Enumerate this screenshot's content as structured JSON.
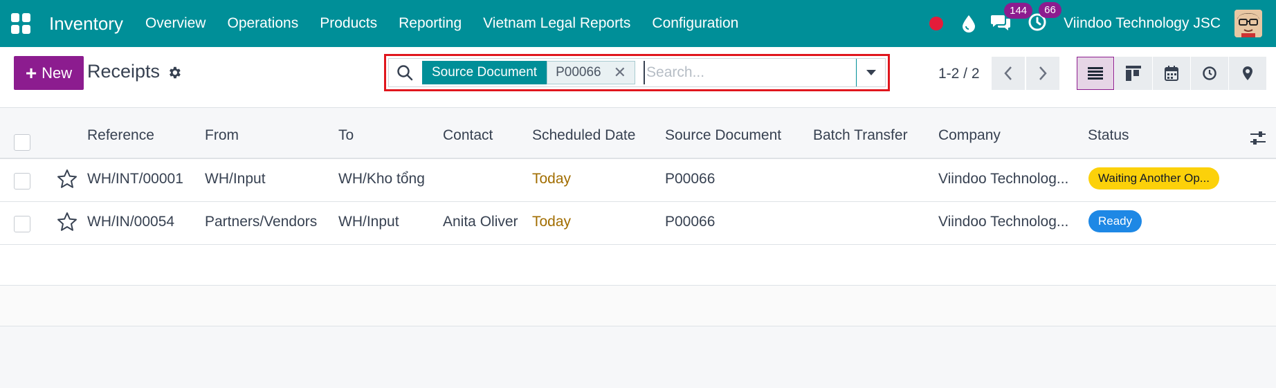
{
  "navbar": {
    "brand": "Inventory",
    "menu": [
      "Overview",
      "Operations",
      "Products",
      "Reporting",
      "Vietnam Legal Reports",
      "Configuration"
    ],
    "messages_count": "144",
    "activities_count": "66",
    "company": "Viindoo Technology JSC"
  },
  "control": {
    "new_label": "New",
    "title": "Receipts",
    "search": {
      "facet_label": "Source Document",
      "facet_value": "P00066",
      "placeholder": "Search..."
    },
    "pager": "1-2 / 2"
  },
  "table": {
    "columns": [
      "Reference",
      "From",
      "To",
      "Contact",
      "Scheduled Date",
      "Source Document",
      "Batch Transfer",
      "Company",
      "Status"
    ],
    "rows": [
      {
        "reference": "WH/INT/00001",
        "from": "WH/Input",
        "to": "WH/Kho tổng",
        "contact": "",
        "scheduled": "Today",
        "source": "P00066",
        "batch": "",
        "company": "Viindoo Technolog...",
        "status": "Waiting Another Op...",
        "status_color": "#fcd10a",
        "status_text_color": "#111827"
      },
      {
        "reference": "WH/IN/00054",
        "from": "Partners/Vendors",
        "to": "WH/Input",
        "contact": "Anita Oliver",
        "scheduled": "Today",
        "source": "P00066",
        "batch": "",
        "company": "Viindoo Technolog...",
        "status": "Ready",
        "status_color": "#1e88e5",
        "status_text_color": "#ffffff"
      }
    ]
  },
  "colors": {
    "navbar": "#008f98",
    "primary": "#8c1c8f",
    "highlight_border": "#e0161d"
  }
}
